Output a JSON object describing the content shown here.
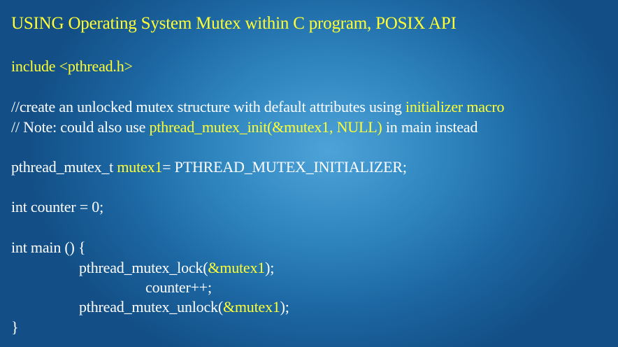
{
  "slide": {
    "title": "USING Operating System Mutex within C program, POSIX API",
    "include_line": "include <pthread.h>",
    "comment1": {
      "prefix": "//create an unlocked mutex structure with default attributes using ",
      "highlight": "initializer macro"
    },
    "comment2": {
      "prefix": "// Note: could also use ",
      "highlight": "pthread_mutex_init(&mutex1, NULL)",
      "suffix": " in main instead"
    },
    "decl": {
      "type": "pthread_mutex_t ",
      "name": "mutex1",
      "rest": "= PTHREAD_MUTEX_INITIALIZER;"
    },
    "counter_decl": "int counter = 0;",
    "main_open": "int main () {",
    "lock": {
      "call": "pthread_mutex_lock(",
      "arg": "&mutex1",
      "close": ");"
    },
    "increment": "counter++;",
    "unlock": {
      "call": "pthread_mutex_unlock(",
      "arg": "&mutex1",
      "close": ");"
    },
    "main_close": "}"
  },
  "colors": {
    "highlight": "#ffff33",
    "text": "#ffffff",
    "background": "#2f86bf"
  }
}
